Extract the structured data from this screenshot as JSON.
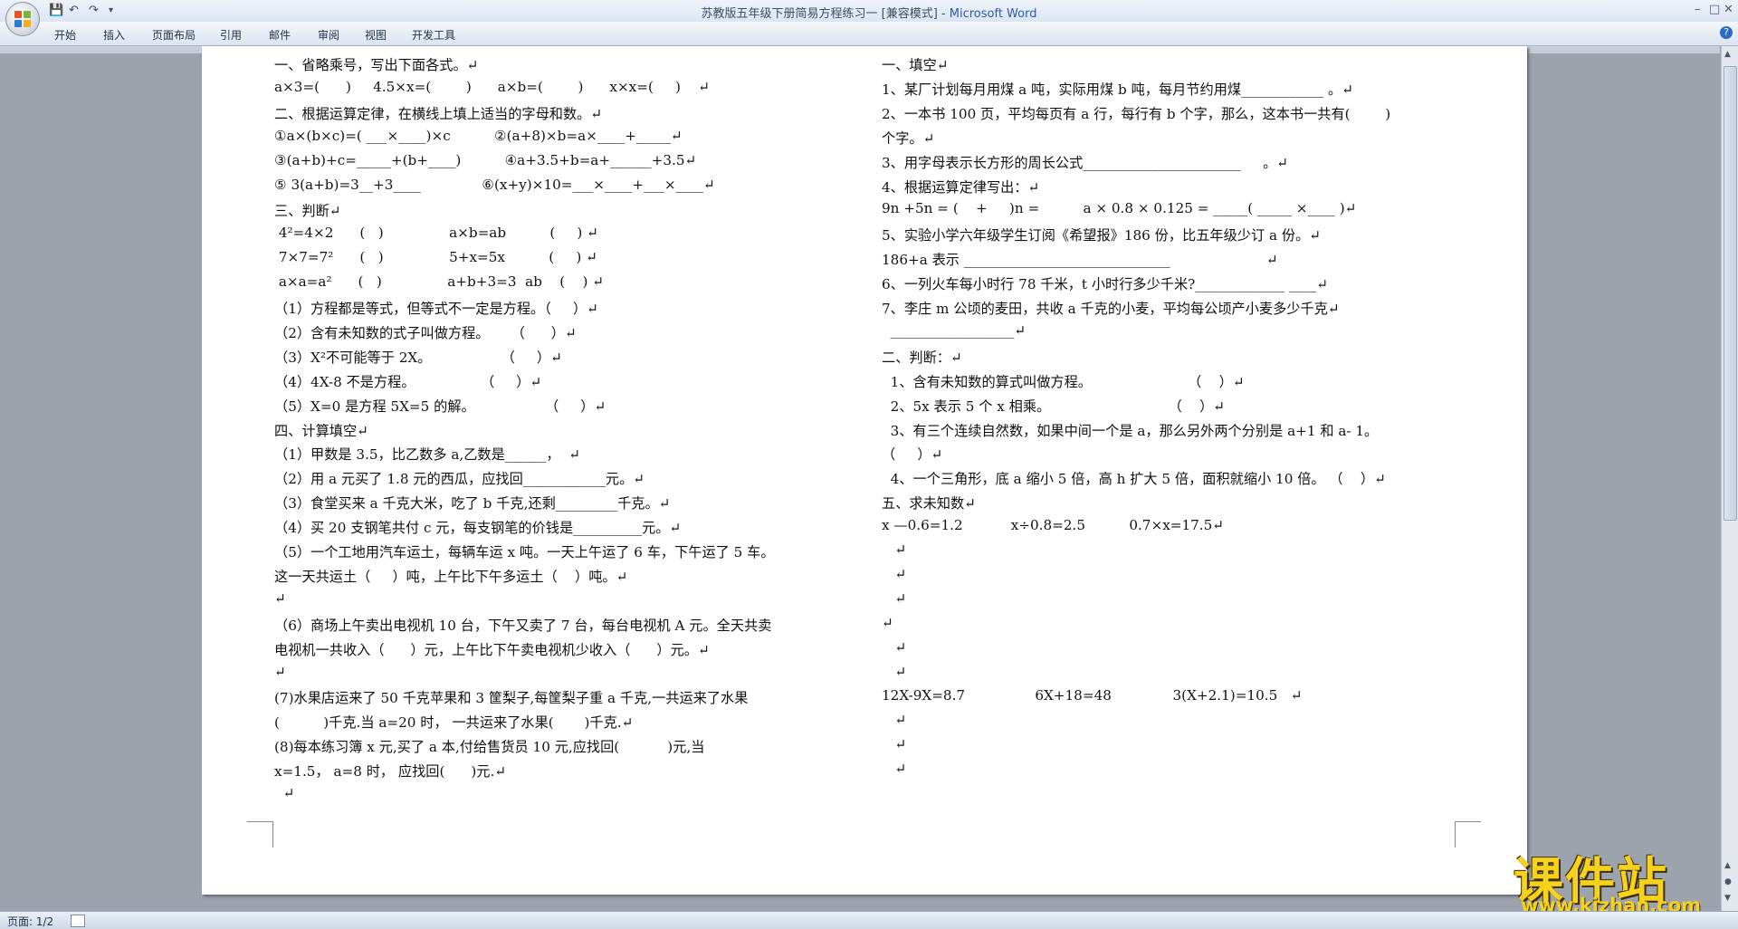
{
  "window": {
    "title": "苏教版五年级下册简易方程练习一 [兼容模式] - ",
    "app_name": "Microsoft Word",
    "quick_access": [
      "save-icon",
      "undo-icon",
      "redo-icon",
      "customize-icon"
    ],
    "controls": {
      "minimize": "–",
      "restore": "□",
      "close": "✕"
    }
  },
  "ribbon": {
    "tabs": [
      "开始",
      "插入",
      "页面布局",
      "引用",
      "邮件",
      "审阅",
      "视图",
      "开发工具"
    ],
    "help": "?"
  },
  "status": {
    "page": "页面: 1/2"
  },
  "watermark": {
    "logo": "课件站",
    "url": "www.kjzhan.com"
  },
  "document": {
    "left_column": [
      "一、省略乘号，写出下面各式。↵",
      "a×3=(      )     4.5×x=(        )      a×b=(        )      x×x=(     )    ↵",
      "二、根据运算定律，在横线上填上适当的字母和数。↵",
      "①a×(b×c)=( ___×____)×c          ②(a+8)×b=a×____+_____↵",
      "③(a+b)+c=_____+(b+____)          ④a+3.5+b=a+______+3.5↵",
      "⑤ 3(a+b)=3__+3____              ⑥(x+y)×10=___×____+___×____↵",
      "三、判断↵",
      " 4²=4×2      (   )               a×b=ab          (     ) ↵",
      " 7×7=7²      (   )               5+x=5x          (     ) ↵",
      " a×a=a²      (   )               a+b+3=3  ab    (    ) ↵",
      "（1）方程都是等式，但等式不一定是方程。（     ）↵",
      "（2）含有未知数的式子叫做方程。     （      ）↵",
      "（3）X²不可能等于 2X。                （     ）↵",
      "（4）4X-8 不是方程。               （     ）↵",
      "（5）X=0 是方程 5X=5 的解。                （     ）↵",
      "四、计算填空↵",
      "（1）甲数是 3.5，比乙数多 a,乙数是______，  ↵",
      "（2）用 a 元买了 1.8 元的西瓜，应找回____________元。↵",
      "（3）食堂买来 a 千克大米，吃了 b 千克,还剩_________千克。↵",
      "（4）买 20 支钢笔共付 c 元，每支钢笔的价钱是__________元。↵",
      "（5）一个工地用汽车运土，每辆车运 x 吨。一天上午运了 6 车，下午运了 5 车。",
      "这一天共运土（     ）吨，上午比下午多运土（    ）吨。↵",
      "↵",
      "（6）商场上午卖出电视机 10 台，下午又卖了 7 台，每台电视机 A 元。全天共卖",
      "电视机一共收入（      ）元，上午比下午卖电视机少收入（      ）元。↵",
      "↵",
      "(7)水果店运来了 50 千克苹果和 3 筐梨子,每筐梨子重 a 千克,一共运来了水果",
      "(          )千克.当 a=20 时， 一共运来了水果(       )千克.↵",
      "(8)每本练习簿 x 元,买了 a 本,付给售货员 10 元,应找回(           )元,当",
      "x=1.5， a=8 时， 应找回(      )元.↵",
      "  ↵"
    ],
    "right_column": [
      "一、填空↵",
      "1、某厂计划每月用煤 a 吨，实际用煤 b 吨，每月节约用煤____________ 。↵",
      "2、一本书 100 页，平均每页有 a 行，每行有 b 个字，那么，这本书一共有(        )",
      "个字。↵",
      "3、用字母表示长方形的周长公式_______________________     。↵",
      "4、根据运算定律写出：↵",
      "9n +5n = (    +     )n =          a × 0.8 × 0.125 = _____( _____ ×____ )↵",
      "5、实验小学六年级学生订阅《希望报》186 份，比五年级少订 a 份。↵",
      "186+a 表示 ______________________________                      ↵",
      "6、一列火车每小时行 78 千米，t 小时行多少千米?_____________ ____↵",
      "7、李庄 m 公顷的麦田，共收 a 千克的小麦，平均每公顷产小麦多少千克↵",
      "  __________________↵",
      "二、判断：↵",
      "  1、含有未知数的算式叫做方程。                      （    ）↵",
      "  2、5x 表示 5 个 x 相乘。                           （    ）↵",
      "  3、有三个连续自然数，如果中间一个是 a，那么另外两个分别是 a+1 和 a- 1。",
      "（     ）↵",
      "  4、一个三角形，底 a 缩小 5 倍，高 h 扩大 5 倍，面积就缩小 10 倍。 （    ）↵",
      "五、求未知数↵",
      "x —0.6=1.2           x÷0.8=2.5          0.7×x=17.5↵",
      "   ↵",
      "   ↵",
      "   ↵",
      "↵",
      "   ↵",
      "   ↵",
      "12X-9X=8.7                6X+18=48              3(X+2.1)=10.5   ↵",
      "   ↵",
      "   ↵",
      "   ↵"
    ]
  }
}
